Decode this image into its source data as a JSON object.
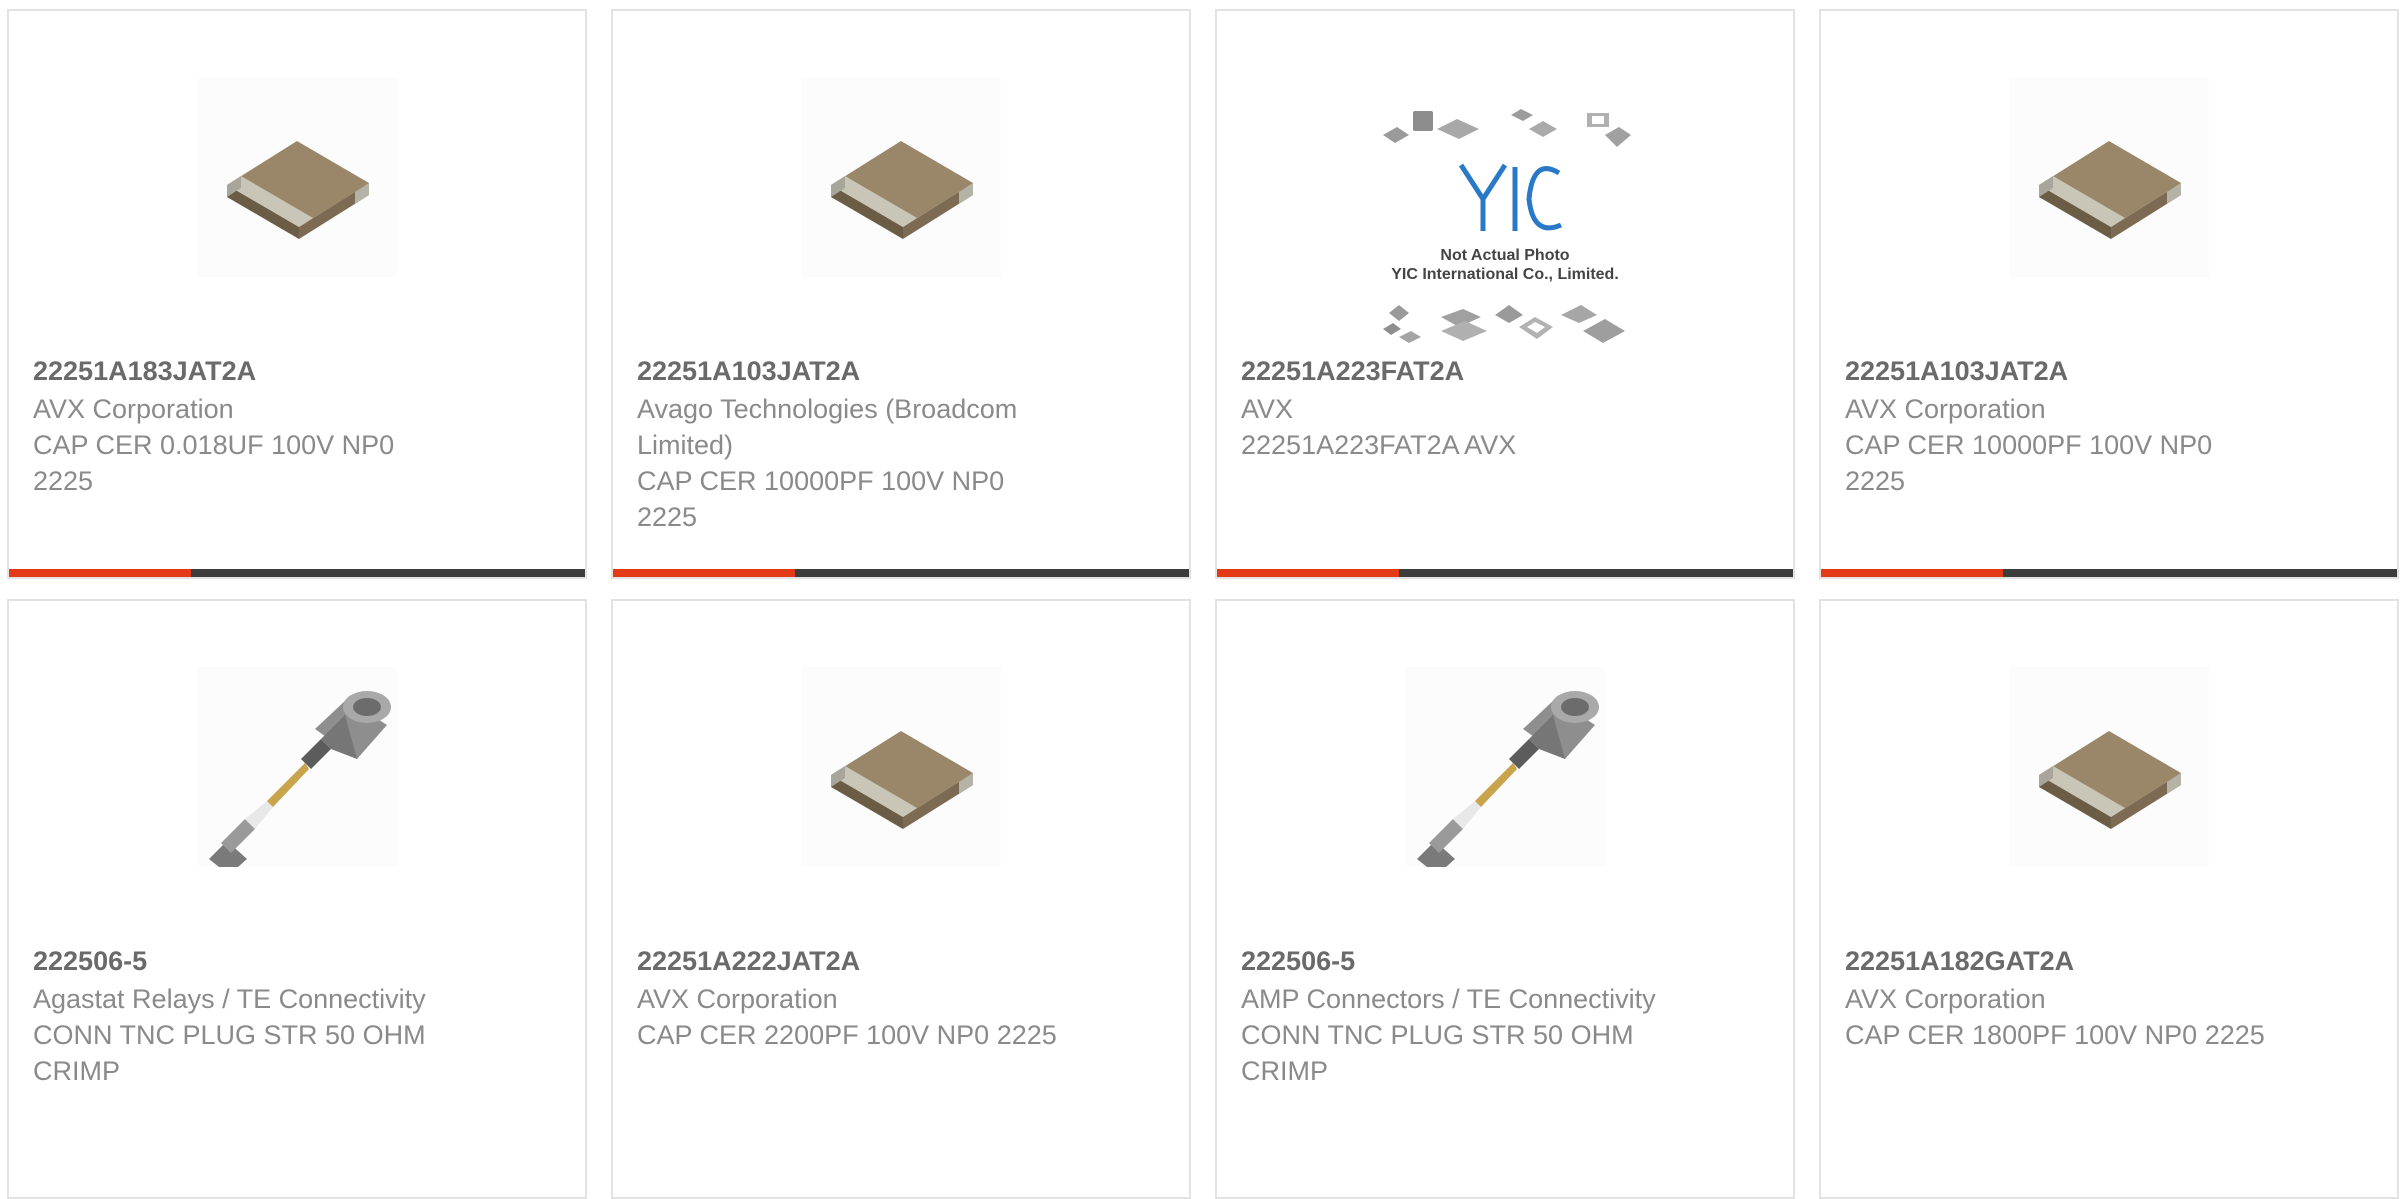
{
  "colors": {
    "accent": "#e23a17",
    "bar_dark": "#3c3c3c",
    "card_border": "#e2e2e2",
    "part_text": "#6a6a6a",
    "body_text": "#8a8a8a"
  },
  "products": [
    {
      "image": "ceramic-capacitor-chip",
      "part_number": "22251A183JAT2A",
      "manufacturer": "AVX Corporation",
      "description": "CAP CER 0.018UF 100V NP0 2225"
    },
    {
      "image": "ceramic-capacitor-chip",
      "part_number": "22251A103JAT2A",
      "manufacturer": "Avago Technologies (Broadcom Limited)",
      "description": "CAP CER 10000PF 100V NP0 2225"
    },
    {
      "image": "yic-not-actual-photo",
      "placeholder_text": [
        "Not Actual Photo",
        "YIC International Co., Limited."
      ],
      "part_number": "22251A223FAT2A",
      "manufacturer": "AVX",
      "description": "22251A223FAT2A AVX"
    },
    {
      "image": "ceramic-capacitor-chip",
      "part_number": "22251A103JAT2A",
      "manufacturer": "AVX Corporation",
      "description": "CAP CER 10000PF 100V NP0 2225"
    },
    {
      "image": "tnc-plug-connector",
      "part_number": "222506-5",
      "manufacturer": "Agastat Relays / TE Connectivity",
      "description": "CONN TNC PLUG STR 50 OHM CRIMP"
    },
    {
      "image": "ceramic-capacitor-chip",
      "part_number": "22251A222JAT2A",
      "manufacturer": "AVX Corporation",
      "description": "CAP CER 2200PF 100V NP0 2225"
    },
    {
      "image": "tnc-plug-connector",
      "part_number": "222506-5",
      "manufacturer": "AMP Connectors / TE Connectivity",
      "description": "CONN TNC PLUG STR 50 OHM CRIMP"
    },
    {
      "image": "ceramic-capacitor-chip",
      "part_number": "22251A182GAT2A",
      "manufacturer": "AVX Corporation",
      "description": "CAP CER 1800PF 100V NP0 2225"
    }
  ]
}
